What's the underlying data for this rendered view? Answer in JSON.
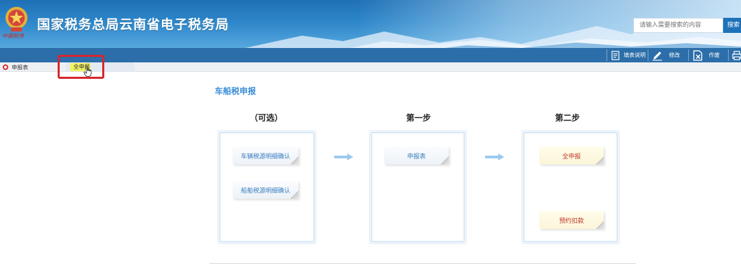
{
  "header": {
    "logo_text": "中国税务",
    "site_title": "国家税务总局云南省电子税务局",
    "search": {
      "placeholder": "请输入需要搜索的内容",
      "button_label": "搜索"
    }
  },
  "toolbar": {
    "items": [
      {
        "label": "填表说明",
        "icon": "document-icon"
      },
      {
        "label": "修改",
        "icon": "edit-pencil-icon"
      },
      {
        "label": "作废",
        "icon": "void-document-icon"
      },
      {
        "label": "",
        "icon": "print-icon"
      }
    ]
  },
  "tabs": {
    "declaration_label": "申报表",
    "full_declaration_label": "全申报"
  },
  "content": {
    "heading": "车船税申报",
    "columns": [
      {
        "title": "（可选）",
        "buttons": [
          "车辆税源明细确认",
          "船舶税源明细确认"
        ]
      },
      {
        "title": "第一步",
        "buttons": [
          "申报表"
        ]
      },
      {
        "title": "第二步",
        "buttons": [
          "全申报",
          "预约扣款"
        ]
      }
    ]
  },
  "colors": {
    "header_blue": "#2b6ea9",
    "heading_blue": "#3b8fd8",
    "highlight_red": "#d8262c",
    "highlight_yellow": "#f3f34a",
    "red_button_text": "#c0392b"
  }
}
